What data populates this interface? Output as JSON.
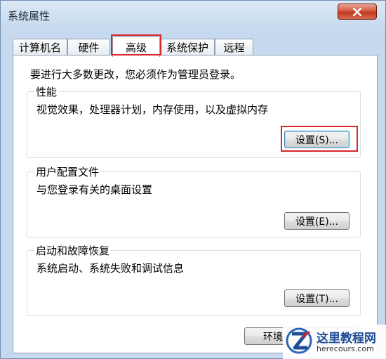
{
  "window": {
    "title": "系统属性"
  },
  "tabs": [
    {
      "label": "计算机名",
      "active": false
    },
    {
      "label": "硬件",
      "active": false
    },
    {
      "label": "高级",
      "active": true
    },
    {
      "label": "系统保护",
      "active": false
    },
    {
      "label": "远程",
      "active": false
    }
  ],
  "panel": {
    "intro": "要进行大多数更改，您必须作为管理员登录。",
    "performance": {
      "title": "性能",
      "description": "视觉效果，处理器计划，内存使用，以及虚拟内存",
      "button": "设置(S)..."
    },
    "profiles": {
      "title": "用户配置文件",
      "description": "与您登录有关的桌面设置",
      "button": "设置(E)..."
    },
    "startup": {
      "title": "启动和故障恢复",
      "description": "系统启动、系统失败和调试信息",
      "button": "设置(T)..."
    },
    "env_button": "环境"
  },
  "watermark": {
    "name": "这里教程网",
    "url": "herecours.com"
  },
  "colors": {
    "highlight": "#d8262b",
    "close_button": "#c0391f",
    "title_gradient": "#c6d9ee"
  },
  "icons": {
    "close": "close-icon",
    "watermark_logo": "z-logo-icon"
  }
}
